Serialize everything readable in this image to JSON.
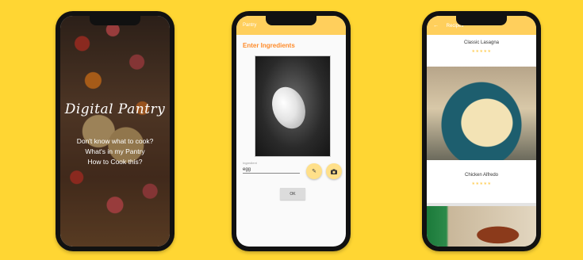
{
  "splash": {
    "title": "Digital Pantry",
    "lines": [
      "Don't know what to cook?",
      "What's in my Pantry",
      "How to Cook this?"
    ]
  },
  "ingredients": {
    "appbar_title": "Pantry",
    "heading": "Enter Ingredients",
    "field_label": "Ingredient",
    "field_value": "egg",
    "ok_label": "OK"
  },
  "recipes": {
    "appbar_title": "Recipes",
    "items": [
      {
        "name": "Classic Lasagna",
        "rating": "★★★★★"
      },
      {
        "name": "Chicken Alfredo",
        "rating": "★★★★★"
      }
    ]
  },
  "colors": {
    "background": "#ffd633",
    "accent": "#ffcf5c",
    "heading": "#ff8c2b"
  },
  "icons": [
    "back-arrow-icon",
    "pencil-icon",
    "camera-icon",
    "star-icon"
  ]
}
